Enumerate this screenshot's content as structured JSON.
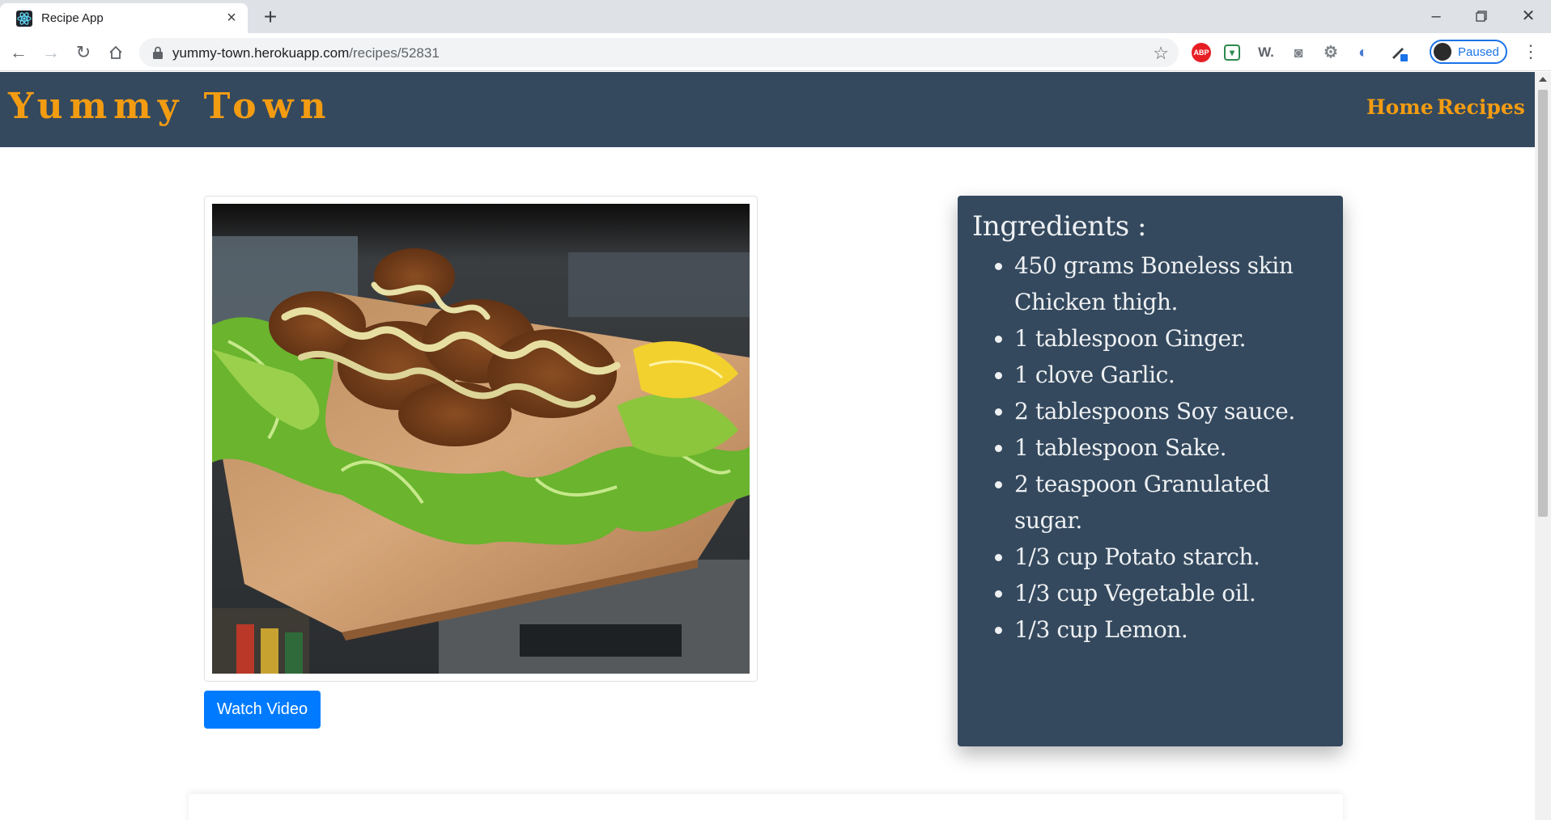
{
  "browser": {
    "tab_title": "Recipe App",
    "url_host": "yummy-town.herokuapp.com",
    "url_path": "/recipes/52831",
    "profile_status": "Paused",
    "extensions": [
      "abp-icon",
      "pocket-icon",
      "w-icon",
      "camera-icon",
      "gear-extension-icon",
      "swirl-icon",
      "pen-icon"
    ]
  },
  "header": {
    "brand": "Yummy Town",
    "nav": [
      {
        "label": "Home"
      },
      {
        "label": "Recipes"
      }
    ]
  },
  "recipe": {
    "watch_label": "Watch Video",
    "ingredients_title": "Ingredients :",
    "ingredients": [
      "450 grams Boneless skin Chicken thigh.",
      "1 tablespoon Ginger.",
      "1 clove Garlic.",
      "2 tablespoons Soy sauce.",
      "1 tablespoon Sake.",
      "2 teaspoon Granulated sugar.",
      "1/3 cup Potato starch.",
      "1/3 cup Vegetable oil.",
      "1/3 cup Lemon."
    ]
  },
  "colors": {
    "header_bg": "#34495e",
    "brand": "#f39c12",
    "button": "#007bff"
  }
}
